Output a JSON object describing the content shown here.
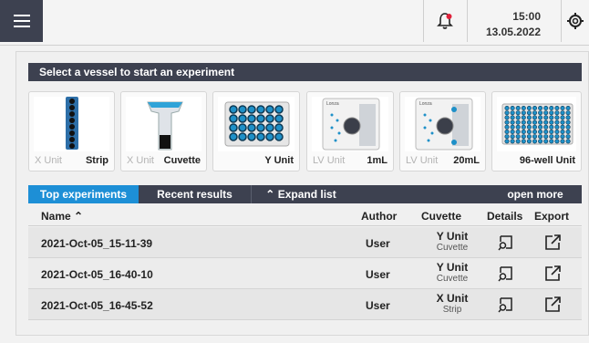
{
  "topbar": {
    "time": "15:00",
    "date": "13.05.2022"
  },
  "vessel_section": {
    "header": "Select a vessel to start an experiment",
    "vessels": [
      {
        "left_label": "X Unit",
        "right_label": "Strip",
        "left_active": false,
        "right_active": true
      },
      {
        "left_label": "X Unit",
        "right_label": "Cuvette",
        "left_active": false,
        "right_active": true
      },
      {
        "left_label": "",
        "right_label": "Y Unit",
        "left_active": false,
        "right_active": true
      },
      {
        "left_label": "LV Unit",
        "right_label": "1mL",
        "left_active": false,
        "right_active": true
      },
      {
        "left_label": "LV Unit",
        "right_label": "20mL",
        "left_active": false,
        "right_active": true
      },
      {
        "left_label": "",
        "right_label": "96-well Unit",
        "left_active": false,
        "right_active": true
      }
    ],
    "brand_small": "Lonza"
  },
  "tabs": {
    "top_experiments": "Top experiments",
    "recent_results": "Recent results",
    "expand_list": "Expand list",
    "open_more": "open more"
  },
  "table": {
    "headers": {
      "name": "Name",
      "author": "Author",
      "cuvette": "Cuvette",
      "details": "Details",
      "export": "Export"
    },
    "rows": [
      {
        "name": "2021-Oct-05_15-11-39",
        "author": "User",
        "unit": "Y Unit",
        "type": "Cuvette"
      },
      {
        "name": "2021-Oct-05_16-40-10",
        "author": "User",
        "unit": "Y Unit",
        "type": "Cuvette"
      },
      {
        "name": "2021-Oct-05_16-45-52",
        "author": "User",
        "unit": "X Unit",
        "type": "Strip"
      }
    ]
  },
  "colors": {
    "header_dark": "#3d4150",
    "tab_active": "#1d8fd6",
    "well_blue": "#1e90c8",
    "notification_dot": "#e0203a"
  }
}
